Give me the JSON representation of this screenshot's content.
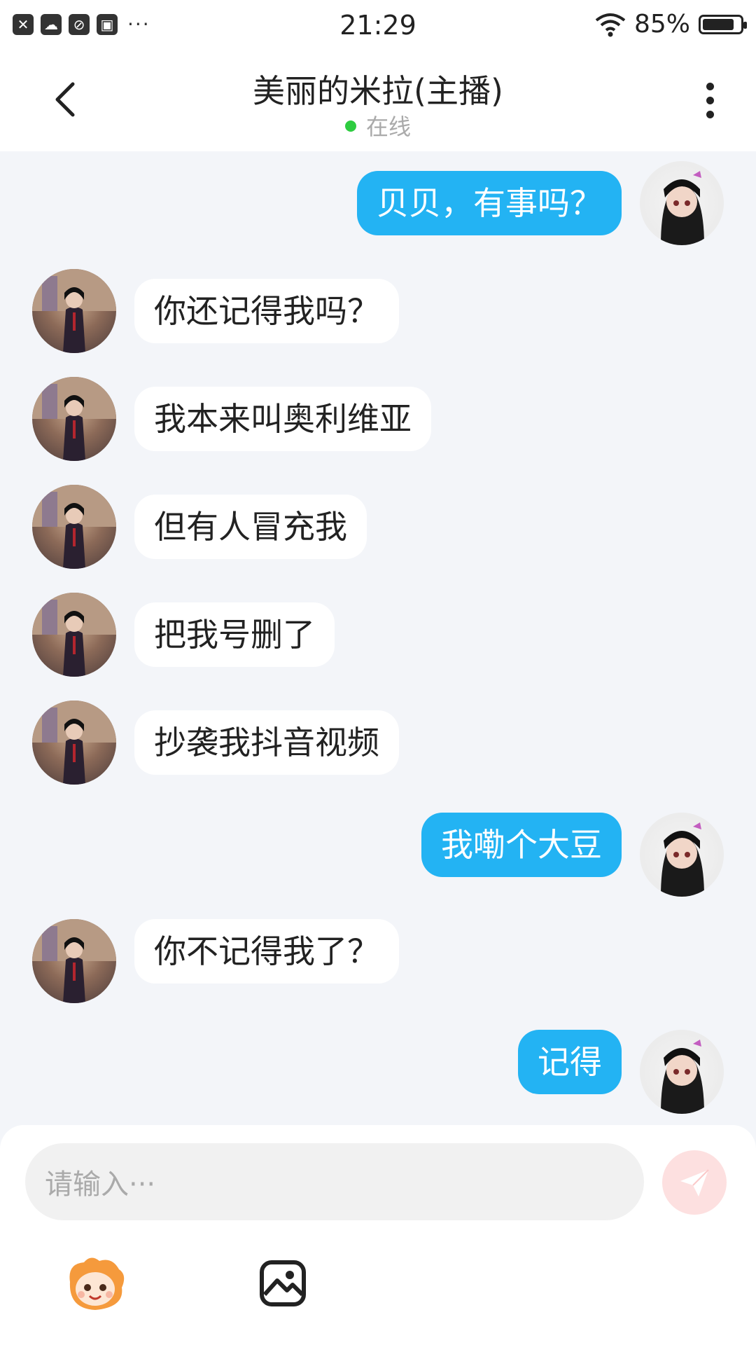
{
  "status_bar": {
    "time": "21:29",
    "battery_text": "85%",
    "battery_level": 0.85,
    "left_icons": [
      "close-app-icon",
      "cloud-icon",
      "no-disturb-icon",
      "gallery-icon"
    ],
    "more_dots": "···"
  },
  "header": {
    "title": "美丽的米拉(主播)",
    "status": "在线",
    "status_color": "#2ecc40"
  },
  "messages": [
    {
      "side": "me",
      "text": "贝贝，有事吗？"
    },
    {
      "side": "other",
      "text": "你还记得我吗？"
    },
    {
      "side": "other",
      "text": "我本来叫奥利维亚"
    },
    {
      "side": "other",
      "text": "但有人冒充我"
    },
    {
      "side": "other",
      "text": "把我号删了"
    },
    {
      "side": "other",
      "text": "抄袭我抖音视频"
    },
    {
      "side": "me",
      "text": "我嘞个大豆"
    },
    {
      "side": "other",
      "text": "你不记得我了？"
    },
    {
      "side": "me",
      "text": "记得"
    }
  ],
  "input": {
    "placeholder": "请输入···"
  },
  "colors": {
    "my_bubble": "#23b3f3",
    "other_bubble": "#ffffff",
    "send_button": "#fde0e0"
  }
}
